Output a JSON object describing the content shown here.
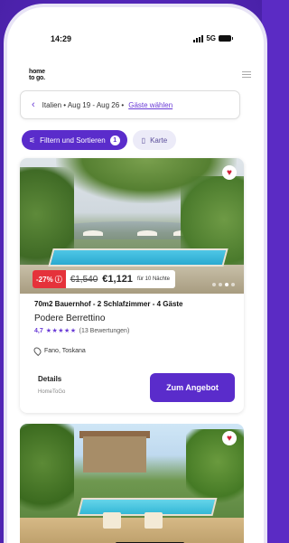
{
  "status_bar": {
    "time": "14:29",
    "network": "5G"
  },
  "header": {
    "logo_line1": "home",
    "logo_line2": "to go."
  },
  "search": {
    "text": "Italien • Aug 19 - Aug 26 •",
    "guests_link": "Gäste wählen"
  },
  "filters": {
    "filter_label": "Filtern und Sortieren",
    "filter_count": "1",
    "map_label": "Karte"
  },
  "listing": {
    "discount": "-27%",
    "old_price": "€1,540",
    "new_price": "€1,121",
    "nights": "für 10 Nächte",
    "subtitle": "70m2 Bauernhof - 2 Schlafzimmer - 4 Gäste",
    "name": "Podere Berrettino",
    "rating": "4,7",
    "stars": "★★★★★",
    "reviews": "(13 Bewertungen)",
    "location": "Fano, Toskana",
    "details_label": "Details",
    "source": "HomeToGo",
    "cta_label": "Zum Angebot"
  },
  "colors": {
    "accent": "#5a2ccb",
    "discount": "#e5323b",
    "heart": "#d0203a"
  }
}
